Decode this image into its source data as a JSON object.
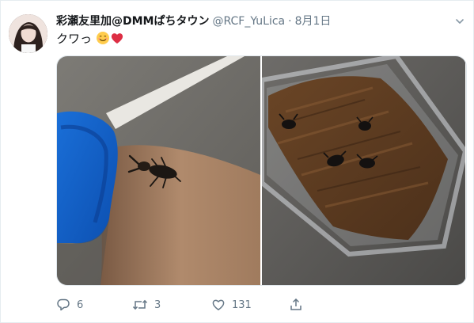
{
  "tweet": {
    "display_name": "彩瀬友里加@DMMぱちタウン",
    "handle": "@RCF_YuLica",
    "separator": "·",
    "date": "8月1日",
    "text": "クワっ"
  },
  "actions": {
    "reply_count": "6",
    "retweet_count": "3",
    "like_count": "131"
  },
  "media": {
    "photo_count": 2
  },
  "colors": {
    "text": "#14171a",
    "secondary": "#657786",
    "border": "#e6ecf0",
    "heart": "#e0245e"
  },
  "icons": [
    "avatar",
    "chevron-down-icon",
    "smiling-face-emoji-icon",
    "red-heart-emoji-icon",
    "reply-icon",
    "retweet-icon",
    "like-icon",
    "share-icon"
  ]
}
